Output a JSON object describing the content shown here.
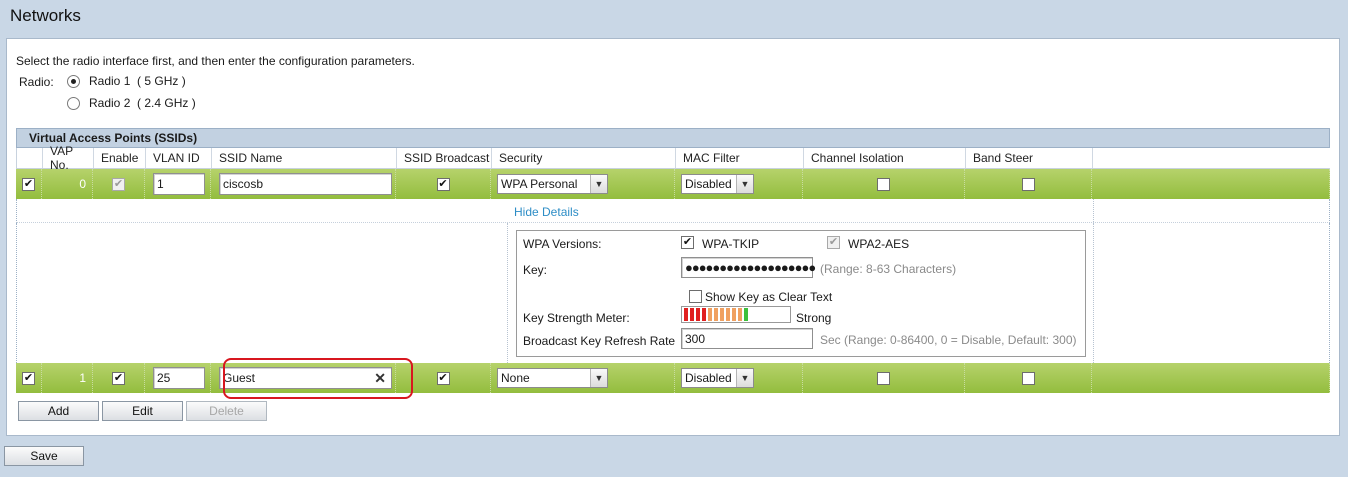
{
  "page": {
    "title": "Networks"
  },
  "instructions": "Select the radio interface first, and then enter the configuration parameters.",
  "radio": {
    "label": "Radio:",
    "options": [
      {
        "label": "Radio 1  ( 5 GHz )",
        "selected": true
      },
      {
        "label": "Radio 2  ( 2.4 GHz )",
        "selected": false
      }
    ]
  },
  "vap_table": {
    "title": "Virtual Access Points (SSIDs)",
    "columns": [
      "VAP No.",
      "Enable",
      "VLAN ID",
      "SSID Name",
      "SSID Broadcast",
      "Security",
      "MAC Filter",
      "Channel Isolation",
      "Band Steer"
    ],
    "rows": [
      {
        "selected": true,
        "vap_no": "0",
        "enable": true,
        "vlan_id": "1",
        "ssid_name": "ciscosb",
        "ssid_broadcast": true,
        "security": "WPA Personal",
        "mac_filter": "Disabled",
        "channel_isolation": false,
        "band_steer": false
      },
      {
        "selected": true,
        "vap_no": "1",
        "enable": true,
        "vlan_id": "25",
        "ssid_name": "Guest",
        "ssid_broadcast": true,
        "security": "None",
        "mac_filter": "Disabled",
        "channel_isolation": false,
        "band_steer": false
      }
    ],
    "details": {
      "hide_link": "Hide Details",
      "wpa_versions_label": "WPA Versions:",
      "wpa_tkip_label": "WPA-TKIP",
      "wpa_tkip_checked": true,
      "wpa2_aes_label": "WPA2-AES",
      "wpa2_aes_checked": true,
      "key_label": "Key:",
      "key_value": "●●●●●●●●●●●●●●●●●●●",
      "key_hint": "(Range: 8-63 Characters)",
      "show_key_label": "Show Key as Clear Text",
      "strength_label": "Key Strength Meter:",
      "strength_value": "Strong",
      "refresh_label": "Broadcast Key Refresh Rate",
      "refresh_value": "300",
      "refresh_hint": "Sec (Range: 0-86400, 0 = Disable, Default: 300)"
    }
  },
  "buttons": {
    "add": "Add",
    "edit": "Edit",
    "delete": "Delete",
    "save": "Save"
  },
  "colors": {
    "row_green": "#a6c855",
    "link": "#2d8dc6",
    "highlight": "#d8171f",
    "background": "#c9d7e6"
  }
}
